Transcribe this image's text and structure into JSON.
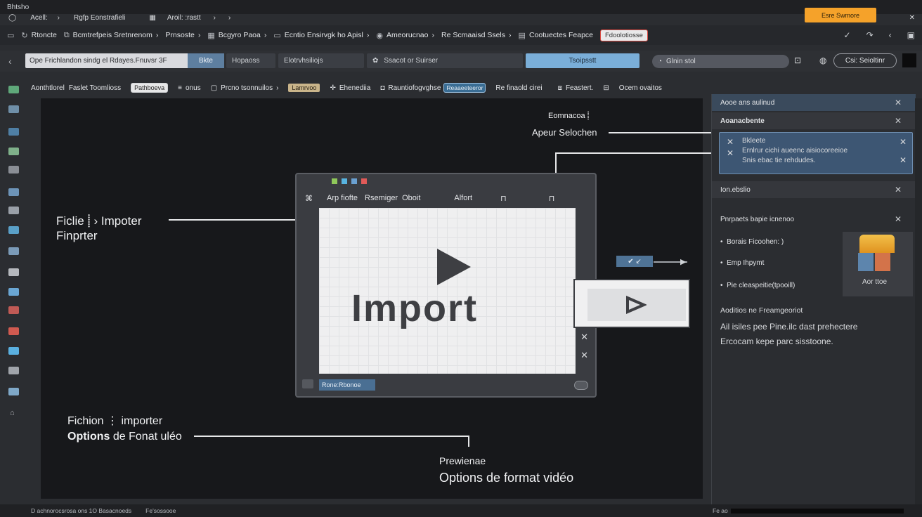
{
  "titlebar": {
    "items": [
      "Bhtsho",
      "Acell:",
      "Rgfp Eonstrafieli",
      "Aroil: :rastt"
    ],
    "accent_button": "Esre Swmore"
  },
  "menubar": {
    "items": [
      {
        "label": "Rtoncte",
        "icon": "refresh-icon"
      },
      {
        "label": "Bcmtrefpeis Sretnrenom",
        "icon": "copy-icon"
      },
      {
        "label": "Prnsoste",
        "icon": "layers-icon"
      },
      {
        "label": "Bcgyro Paoa",
        "icon": "grid-icon"
      },
      {
        "label": "Ecntio Ensirvgk ho Apisl",
        "icon": "monitor-icon"
      },
      {
        "label": "Ameorucnao",
        "icon": "record-icon"
      },
      {
        "label": "Re Scmaaisd Ssels",
        "icon": "tag-icon"
      },
      {
        "label": "Cootuectes Feapce",
        "icon": "folder-icon"
      }
    ],
    "boxed_item": "Fdoolotiosse"
  },
  "addressbar": {
    "path_text": "Ope Frichlandon sindg el Rdayes.Fnuvsr 3F",
    "path_tag": "Bkte",
    "seg1": "Hopaoss",
    "seg2": "Elotrvhsiliojs",
    "seg3": "Ssacot or Suirser",
    "seg_blue": "Tsoipsstt",
    "search": "Glnin stol",
    "pill": "Csi: Seioltinr"
  },
  "toolbar": {
    "items": [
      "Aonthtlorel",
      "Faslet Toomlioss"
    ],
    "chip1": "Pathboeva",
    "item2": "onus",
    "item3": "Prcno tsonnuilos",
    "chip_gold": "Lamrvoo",
    "item4": "Ehenediia",
    "item5": "Rauntiofogvghse",
    "chip_blue": "Reaaeeteeror",
    "item6": "Re finaold cirei",
    "item7": "Feastert.",
    "item8": "Ocem ovaitos"
  },
  "canvas": {
    "label_top1": "Eomnacoa",
    "label_top2": "Apeur Selochen",
    "label_left1": "Ficlie",
    "label_left1b": "Impoter",
    "label_left2": "Finprter",
    "label_bottom1": "Fichion",
    "label_bottom1b": "importer",
    "label_bottom2a": "Options",
    "label_bottom2b": "de Fonat uléo",
    "preview_label": "Prewienae",
    "preview_title": "Options de format vidéo"
  },
  "dialog": {
    "head_items": [
      "Arp fiofte",
      "Rsemiger",
      "Oboit",
      "Alfort"
    ],
    "import_word": "Import",
    "footer_tag": "Rone:Rbonoe"
  },
  "right_panel": {
    "header": "Aooe ans aulinud",
    "section1": "Aoanacbente",
    "selected_line1": "Bkleete",
    "selected_line2": "Ernlrur cichi aueenc aisiocoreeioe",
    "selected_line3": "Snis ebac tie rehdudes.",
    "section2": "Ion.ebslio",
    "section3": "Pnrpaets bapie icnenoo",
    "bullets": [
      "Borais Ficoohen: )",
      "Emp Ihpymt",
      "Pie cleaspeitie(tpooill)"
    ],
    "thumb_label": "Aor ttoe",
    "note_title": "Aoditios ne Freamgeoriot",
    "note_text1": "Ail isiles pee Pine.ilc dast prehectere",
    "note_text2": "Ercocam kepe parc sisstoone."
  },
  "statusbar": {
    "left": "D achnorocsrosa ons 1O Basacnoeds",
    "mid": "Fe'sossooe",
    "right": "Fe ao"
  },
  "colors": {
    "accent": "#f5a22a",
    "selection": "#3d5673",
    "canvas": "#17181b"
  }
}
